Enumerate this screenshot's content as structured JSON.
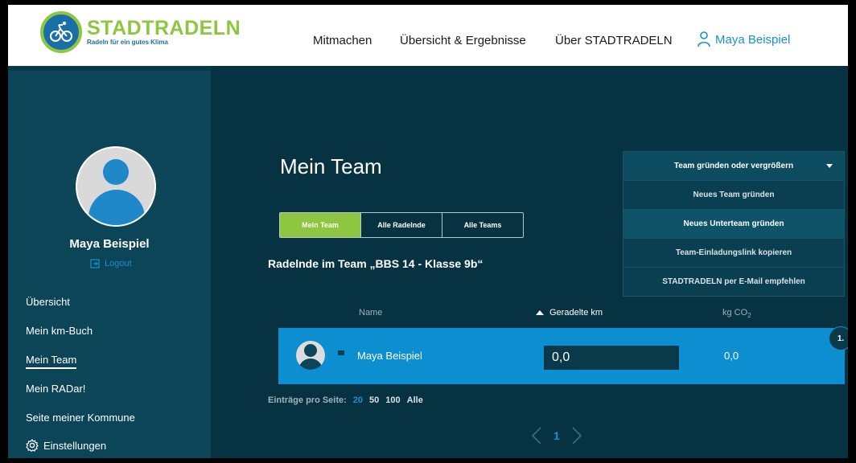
{
  "brand": {
    "title": "STADTRADELN",
    "tagline": "Radeln für ein gutes Klima",
    "colors": {
      "green": "#8dc63f",
      "blue": "#1b6fa8"
    }
  },
  "nav": {
    "items": [
      "Mitmachen",
      "Übersicht & Ergebnisse",
      "Über STADTRADELN"
    ],
    "user": "Maya Beispiel"
  },
  "sidebar": {
    "user_name": "Maya Beispiel",
    "logout": "Logout",
    "items": [
      "Übersicht",
      "Mein km-Buch",
      "Mein Team",
      "Mein RADar!",
      "Seite meiner Kommune",
      "Einstellungen"
    ],
    "active_index": 2
  },
  "main": {
    "title": "Mein Team",
    "tabs": [
      "Mein Team",
      "Alle Radelnde",
      "Alle Teams"
    ],
    "active_tab": 0,
    "subtitle": "Radelnde im Team „BBS 14 - Klasse 9b“",
    "columns": {
      "name": "Name",
      "km": "Geradelte km",
      "co2": "kg CO",
      "co2_sub": "2"
    },
    "rows": [
      {
        "rank": "1.",
        "name": "Maya Beispiel",
        "km": "0,0",
        "co2": "0,0"
      }
    ],
    "per_page": {
      "label": "Einträge pro Seite:",
      "options": [
        "20",
        "50",
        "100",
        "Alle"
      ],
      "active": "20"
    },
    "pager": {
      "page": "1"
    }
  },
  "dropdown": {
    "header": "Team gründen oder vergrößern",
    "items": [
      "Neues Team gründen",
      "Neues Unterteam gründen",
      "Team-Einladungslink kopieren",
      "STADTRADELN per E-Mail empfehlen"
    ],
    "hover_index": 1
  }
}
